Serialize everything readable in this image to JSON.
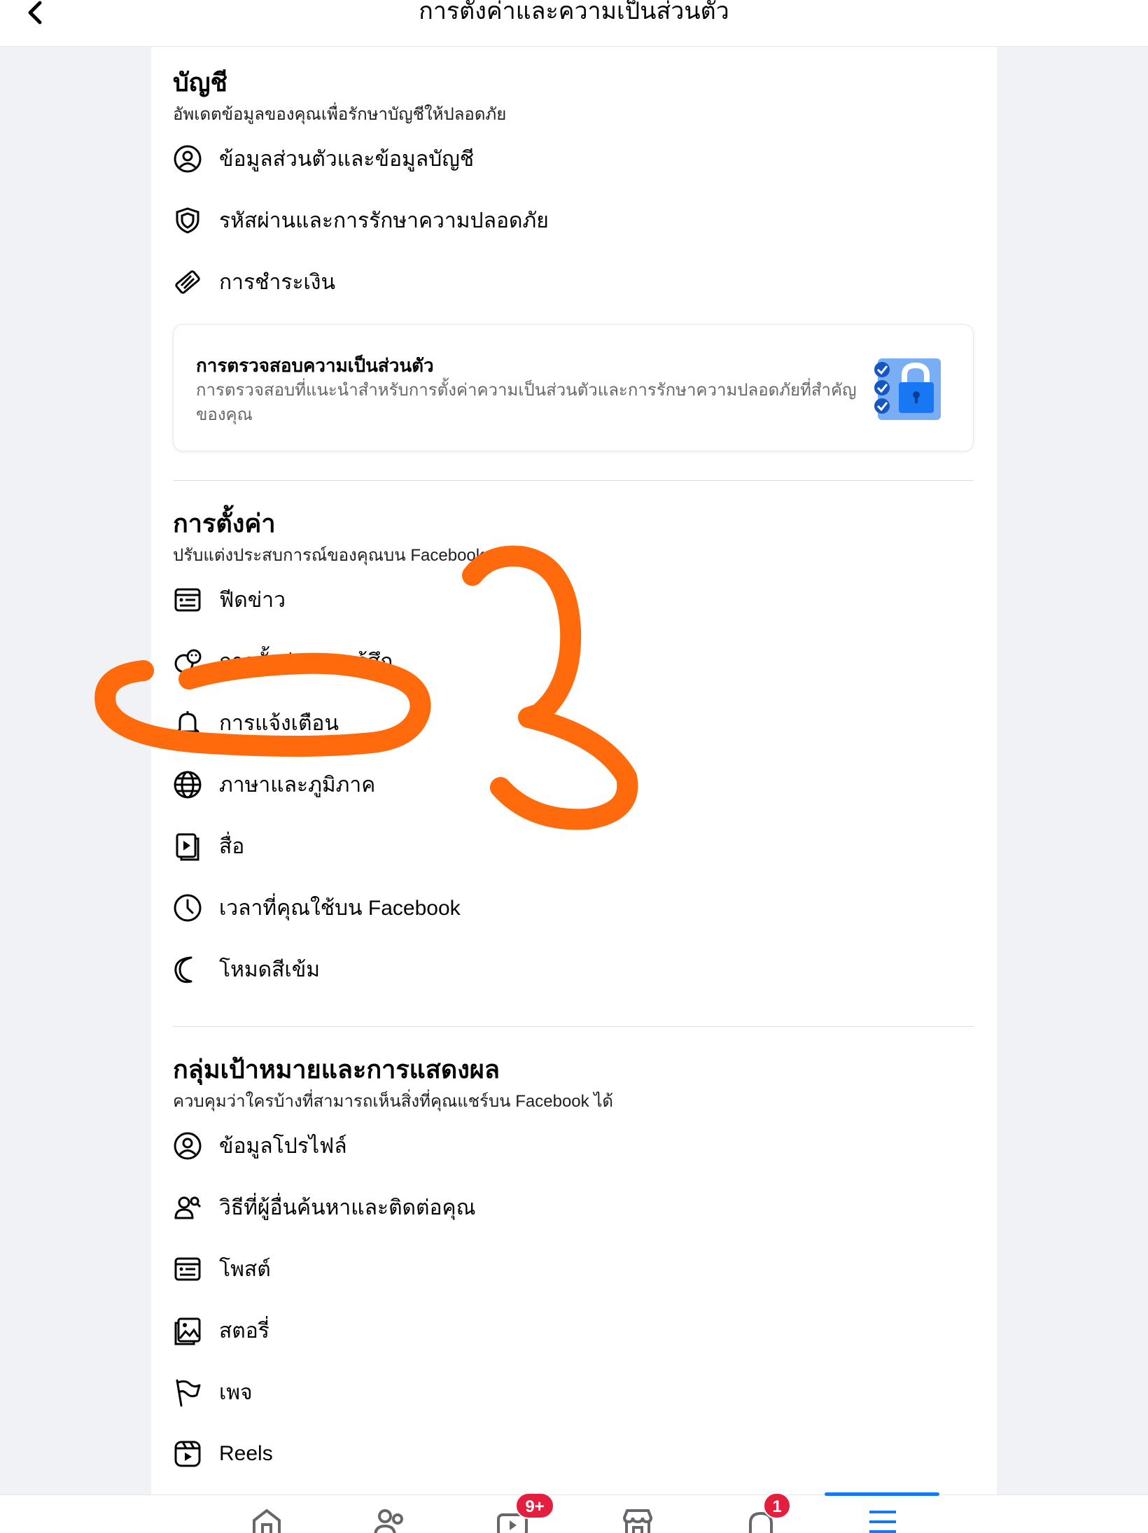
{
  "header": {
    "title": "การตั้งค่าและความเป็นส่วนตัว"
  },
  "account": {
    "title": "บัญชี",
    "subtitle": "อัพเดตข้อมูลของคุณเพื่อรักษาบัญชีให้ปลอดภัย",
    "items": [
      {
        "label": "ข้อมูลส่วนตัวและข้อมูลบัญชี",
        "icon": "user-circle-icon"
      },
      {
        "label": "รหัสผ่านและการรักษาความปลอดภัย",
        "icon": "shield-icon"
      },
      {
        "label": "การชำระเงิน",
        "icon": "tag-icon"
      }
    ],
    "privacy_checkup": {
      "title": "การตรวจสอบความเป็นส่วนตัว",
      "description": "การตรวจสอบที่แนะนำสำหรับการตั้งค่าความเป็นส่วนตัวและการรักษาความปลอดภัยที่สำคัญของคุณ"
    }
  },
  "settings": {
    "title": "การตั้งค่า",
    "subtitle": "ปรับแต่งประสบการณ์ของคุณบน Facebook",
    "items": [
      {
        "label": "ฟีดข่าว",
        "icon": "news-feed-icon"
      },
      {
        "label": "การตั้งค่าความรู้สึก",
        "icon": "reaction-icon"
      },
      {
        "label": "การแจ้งเตือน",
        "icon": "bell-icon"
      },
      {
        "label": "ภาษาและภูมิภาค",
        "icon": "globe-icon"
      },
      {
        "label": "สื่อ",
        "icon": "media-icon"
      },
      {
        "label": "เวลาที่คุณใช้บน Facebook",
        "icon": "clock-icon"
      },
      {
        "label": "โหมดสีเข้ม",
        "icon": "moon-icon"
      }
    ]
  },
  "audience": {
    "title": "กลุ่มเป้าหมายและการแสดงผล",
    "subtitle": "ควบคุมว่าใครบ้างที่สามารถเห็นสิ่งที่คุณแชร์บน Facebook ได้",
    "items": [
      {
        "label": "ข้อมูลโปรไฟล์",
        "icon": "user-circle-icon"
      },
      {
        "label": "วิธีที่ผู้อื่นค้นหาและติดต่อคุณ",
        "icon": "people-search-icon"
      },
      {
        "label": "โพสต์",
        "icon": "post-icon"
      },
      {
        "label": "สตอรี่",
        "icon": "story-icon"
      },
      {
        "label": "เพจ",
        "icon": "flag-icon"
      },
      {
        "label": "Reels",
        "icon": "reels-icon"
      }
    ]
  },
  "annotation": {
    "text": "3",
    "color": "#ff6a0d"
  },
  "bottom_nav": {
    "video_badge": "9+",
    "notifications_badge": "1",
    "icons": [
      "home-icon",
      "friends-icon",
      "video-icon",
      "marketplace-icon",
      "notifications-icon",
      "menu-icon"
    ]
  },
  "colors": {
    "accent": "#1877f2",
    "badge": "#e41e3f",
    "annotation": "#ff6a0d"
  }
}
